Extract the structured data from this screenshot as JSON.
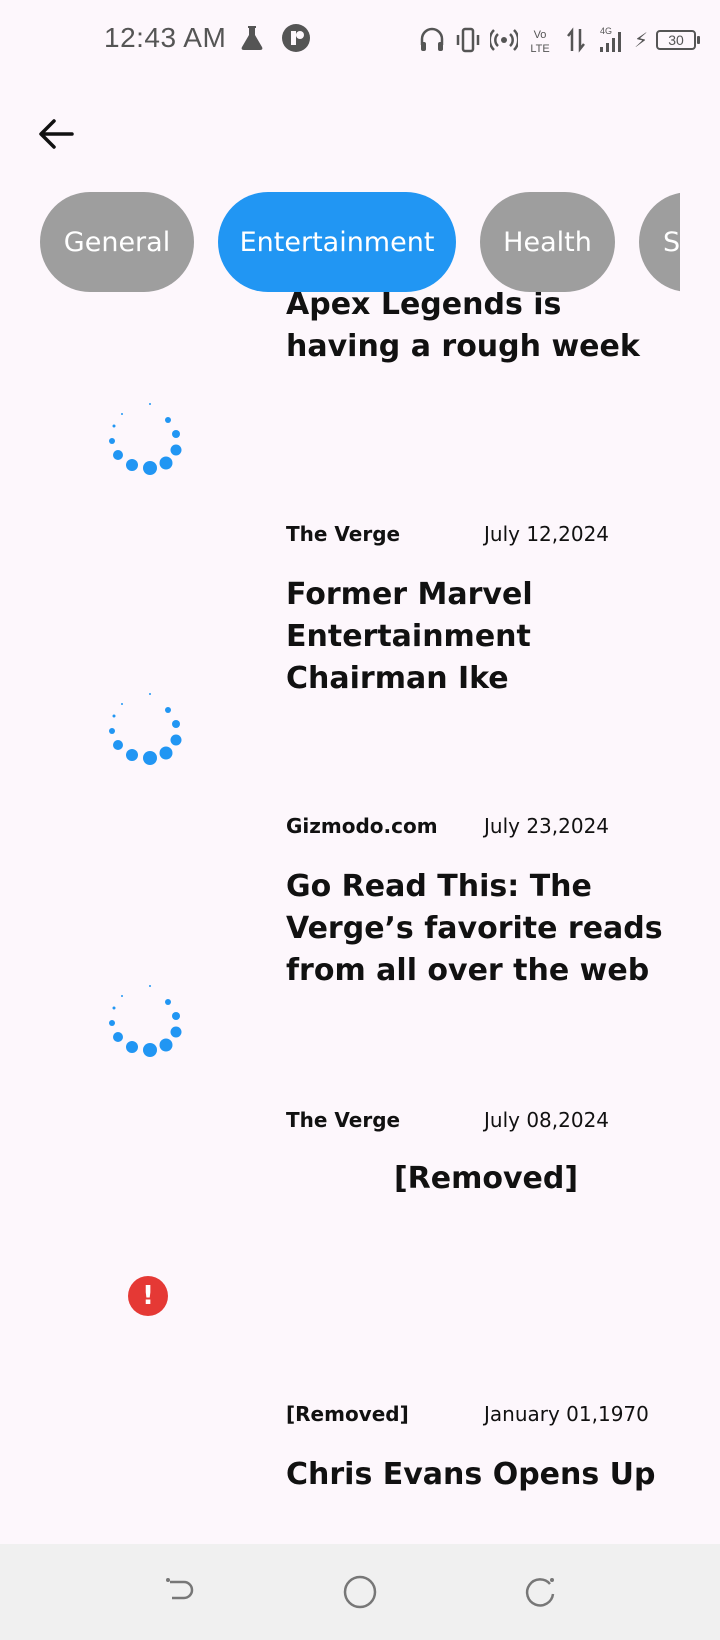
{
  "status_bar": {
    "time": "12:43 AM",
    "battery_level": "30",
    "network_label": "4G",
    "volte_label": "Vo LTE"
  },
  "header": {
    "back_icon": "arrow-left-icon"
  },
  "categories": [
    {
      "label": "General",
      "active": false
    },
    {
      "label": "Entertainment",
      "active": true
    },
    {
      "label": "Health",
      "active": false
    },
    {
      "label": "Sports",
      "active": false
    }
  ],
  "articles": [
    {
      "title": "Apex Legends is having a rough week",
      "source": "The Verge",
      "date": "July 12,2024",
      "image_state": "loading"
    },
    {
      "title": "Former Marvel Entertainment Chairman Ike",
      "source": "Gizmodo.com",
      "date": "July 23,2024",
      "image_state": "loading"
    },
    {
      "title": "Go Read This: The Verge’s favorite reads from all over the web",
      "source": "The Verge",
      "date": "July 08,2024",
      "image_state": "loading"
    },
    {
      "title": "[Removed]",
      "source": "[Removed]",
      "date": "January 01,1970",
      "image_state": "error"
    },
    {
      "title": "Chris Evans Opens Up",
      "source": "",
      "date": "",
      "image_state": "loading"
    }
  ],
  "colors": {
    "accent": "#2196f3",
    "chip_inactive": "#9e9e9e",
    "error": "#e53935",
    "background": "#fdf7fc"
  },
  "nav_bar": {
    "back_icon": "nav-back-icon",
    "home_icon": "nav-home-icon",
    "recents_icon": "nav-recents-icon"
  }
}
